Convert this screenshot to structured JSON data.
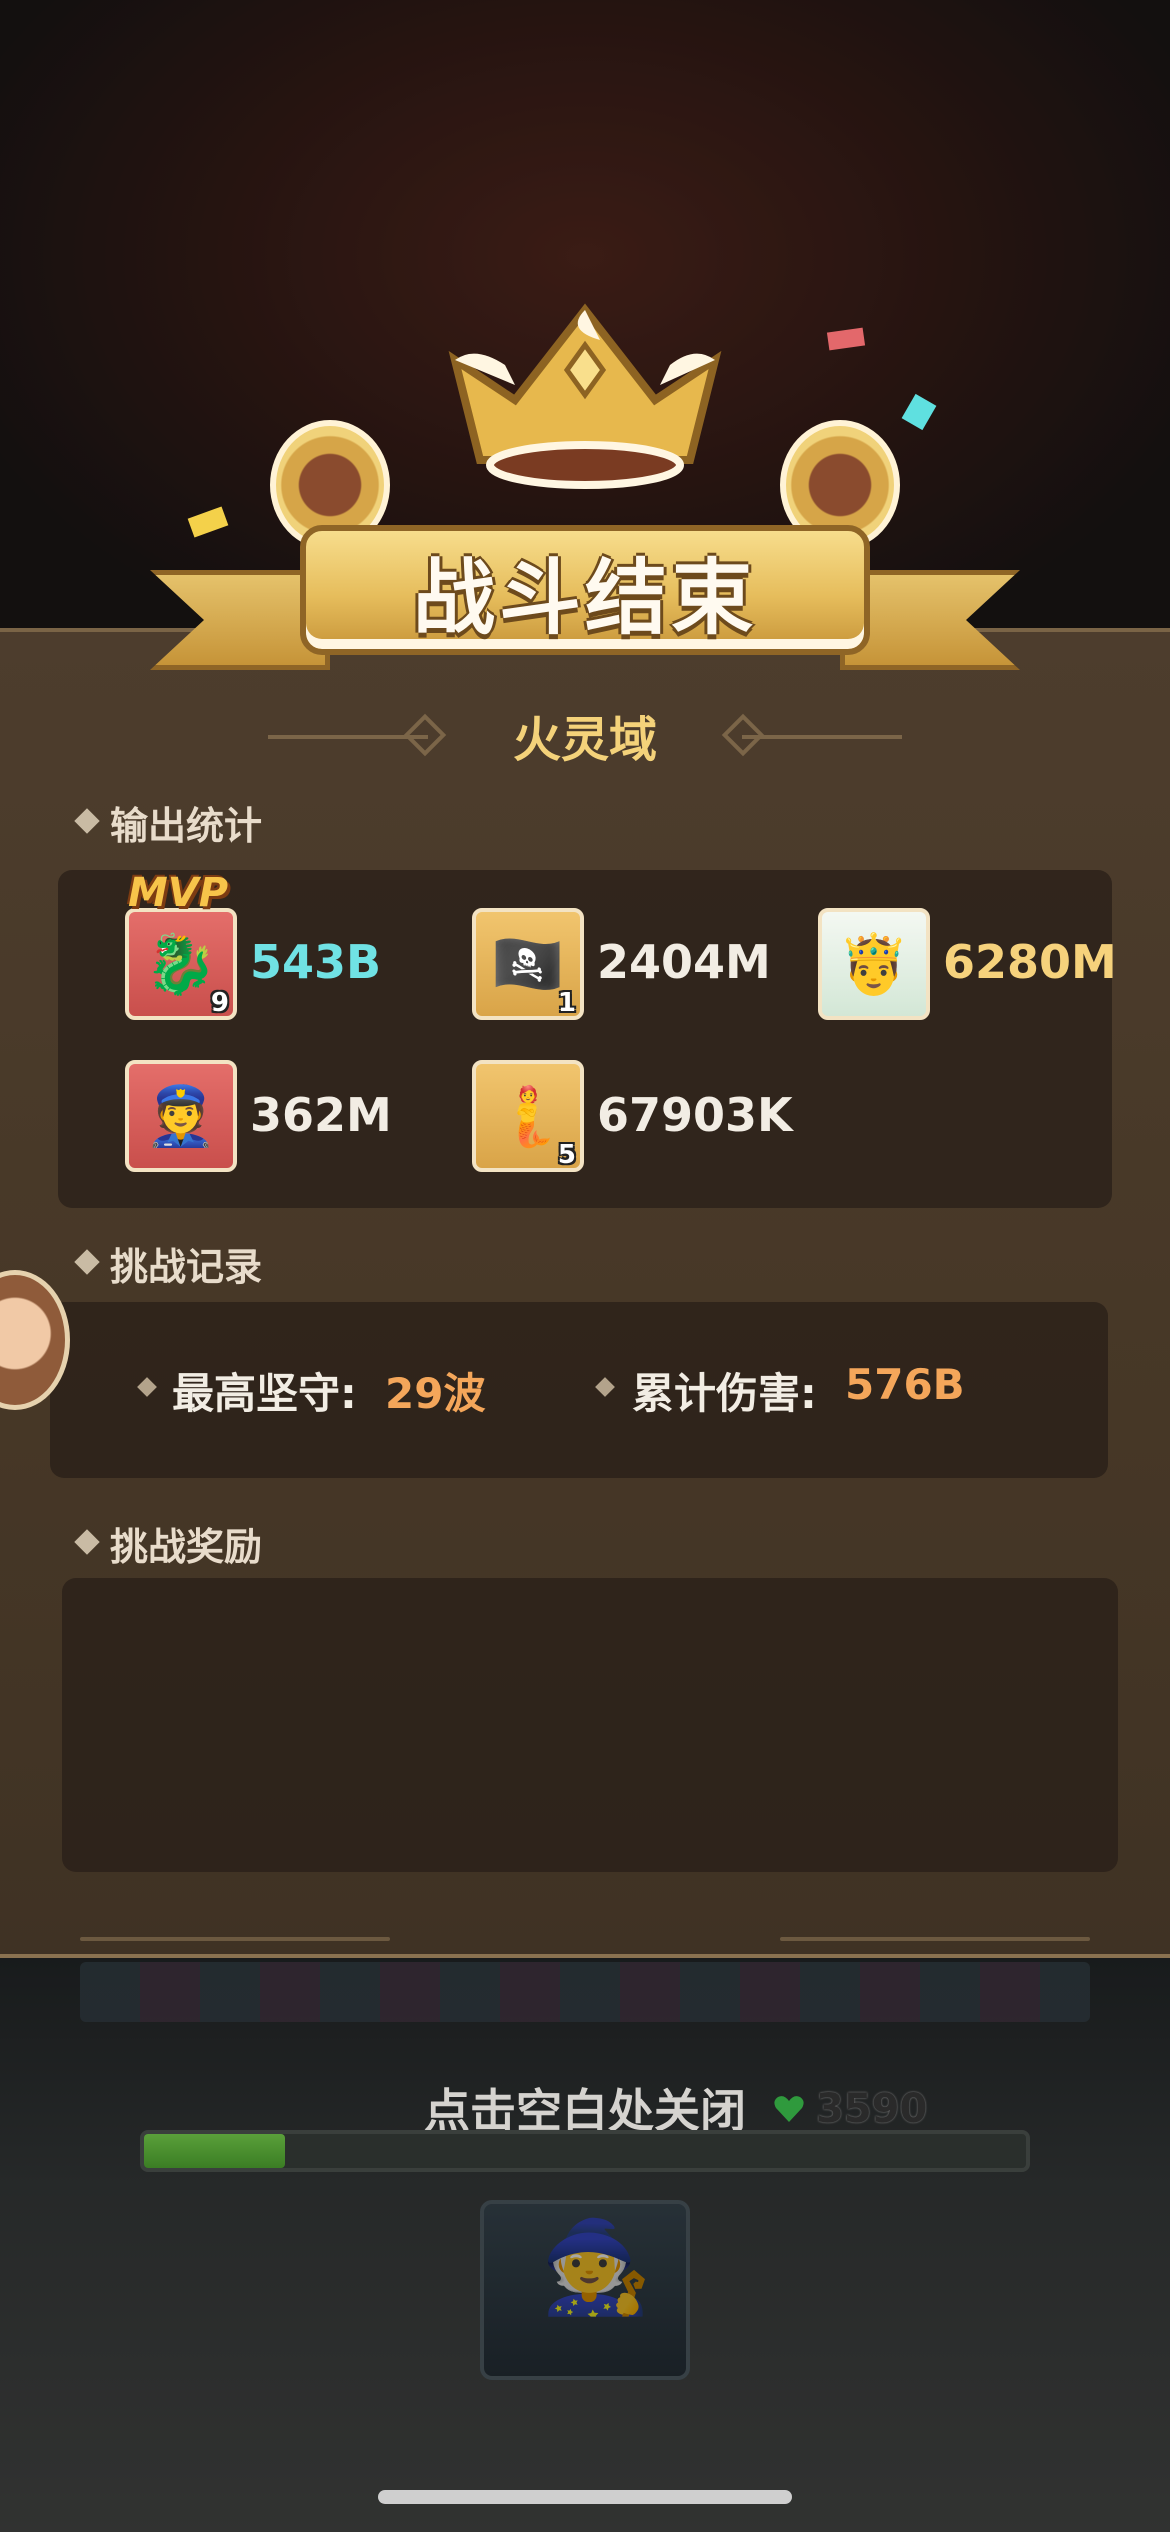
{
  "banner": {
    "title": "战斗结束"
  },
  "zone": {
    "name": "火灵域"
  },
  "output_stats": {
    "label": "输出统计",
    "mvp_badge": "MVP",
    "heroes": [
      {
        "icon": "knight-dragon-hero-icon",
        "level": "9",
        "damage": "543B",
        "color": "#70e2e4"
      },
      {
        "icon": "pirate-hero-icon",
        "level": "1",
        "damage": "2404M",
        "color": "#f2ede4"
      },
      {
        "icon": "king-hero-icon",
        "level": "",
        "damage": "6280M",
        "color": "#f6d27c"
      },
      {
        "icon": "captain-hero-icon",
        "level": "",
        "damage": "362M",
        "color": "#f2ede4"
      },
      {
        "icon": "mermaid-hero-icon",
        "level": "5",
        "damage": "67903K",
        "color": "#f2ede4"
      }
    ]
  },
  "challenge_record": {
    "label": "挑战记录",
    "best_hold_label": "最高坚守:",
    "best_hold_value": "29波",
    "total_damage_label": "累计伤害:",
    "total_damage_value": "576B"
  },
  "challenge_reward": {
    "label": "挑战奖励"
  },
  "footer": {
    "close_hint": "点击空白处关闭",
    "gem_count": "3590",
    "progress": 0.16
  }
}
